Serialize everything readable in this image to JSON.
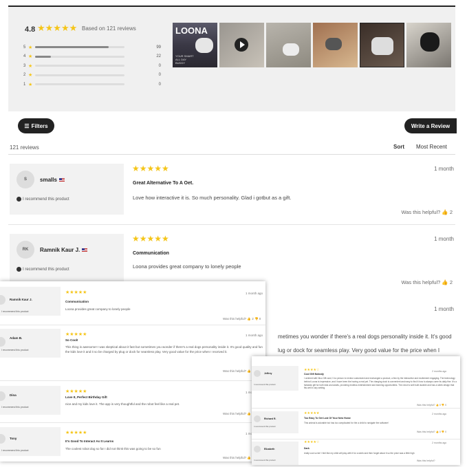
{
  "summary": {
    "average": "4.8",
    "stars": "★★★★★",
    "based_on": "Based on 121 reviews",
    "histogram": [
      {
        "label": "5",
        "count": "99",
        "fraction": 0.82
      },
      {
        "label": "4",
        "count": "22",
        "fraction": 0.18
      },
      {
        "label": "3",
        "count": "0",
        "fraction": 0
      },
      {
        "label": "2",
        "count": "0",
        "fraction": 0
      },
      {
        "label": "1",
        "count": "0",
        "fraction": 0
      }
    ],
    "thumb1_title": "LOONA",
    "thumb1_subtitle": "YOUR SMART ALL DAY BUDDY"
  },
  "toolbar": {
    "filters_label": "Filters",
    "write_label": "Write a Review",
    "review_count": "121 reviews",
    "sort_label": "Sort",
    "sort_value": "Most Recent"
  },
  "reviews": [
    {
      "initials": "S",
      "name": "smalls",
      "recommend": "I recommend this product",
      "stars": "★★★★★",
      "date": "1 month",
      "title": "Great Alternative To A Oet.",
      "body": "Love how interactive it is. So much personality. Glad i gotbut as a gift.",
      "helpful": "Was this helpful?",
      "helpful_count": "2"
    },
    {
      "initials": "RK",
      "name": "Ramnik Kaur J.",
      "recommend": "I recommend this product",
      "stars": "★★★★★",
      "date": "1 month",
      "title": "Communication",
      "body": "Loona provides great company to lonely people",
      "helpful": "Was this helpful?",
      "helpful_count": "2"
    },
    {
      "date": "1 month",
      "body_line1": "metimes you wonder if there's a real dogs personality inside it. It's good",
      "body_line2": "lug or dock for seamless play. Very good value for the price when I"
    }
  ],
  "overlay_a": [
    {
      "name": "Ramnik Kaur J.",
      "recommend": "I recommend this product",
      "stars": "★★★★★",
      "title": "Communication",
      "body": "Loona provides great company to lonely people",
      "date": "1 month ago",
      "helpful": "Was this helpful? 👍 2 👎 0"
    },
    {
      "name": "Adam B.",
      "recommend": "I recommend this product",
      "stars": "★★★★★",
      "title": "So Cool!",
      "body": "This thing is awesome! I was skeptical about it fast but sometimes you wonder if there's a real dogs personality inside it. It's good quality and fun the kids love it and it so be charged by plug or dock for seamless play. Very good value for the price when I received it.",
      "date": "1 month ago",
      "helpful": "Was this helpful? 👍 2 👎 0"
    },
    {
      "name": "Dina",
      "recommend": "I recommend this product",
      "stars": "★★★★★",
      "title": "Love It, Perfect Birthday Gift",
      "body": "nice and my kids love it. The app is very thoughtful and the robot feel like a real pet.",
      "date": "1 month ago",
      "helpful": "Was this helpful? 👍 0 👎 0"
    },
    {
      "name": "Tony",
      "recommend": "I recommend this product",
      "stars": "★★★★★",
      "title": "It's Good To Interact As It Learns",
      "body": "The coolest robot dog so far I did not think this was going to be so fun",
      "date": "1 month ago",
      "helpful": "Was this helpful? 👍 0 👎 0"
    }
  ],
  "overlay_b": [
    {
      "name": "Jeffrey",
      "recommend": "I recommend this product",
      "stars": "★★★★☆",
      "title": "Cool Gift Nobody",
      "body": "I ordered with Nico Gift card, I'd a person to review customized and exchanged a product, a few by the interactive and excitement engaging. The technology behind Loona is impressive, and I have been the having a real pet. The charging dock is convenient and easy to find it how to always come its daily fine. It's a fantastic gift for both kids and adults, providing endless entertainment and learning opportunities. The robot is well built durable and has a sleek design that fits well in any setting.",
      "date": "2 months ago",
      "helpful": "Was this helpful? 👍 0 👎 0"
    },
    {
      "name": "Richard R.",
      "recommend": "I recommend this product",
      "stars": "★★★★★",
      "title": "Too Easy To Get Lost Of Your New Home",
      "body": "This animal is adorable but has too complicated for the a child to navigate the software!",
      "date": "2 months ago",
      "helpful": "Was this helpful? 👍 0 👎 0"
    },
    {
      "name": "Elizabeth",
      "recommend": "I recommend this product",
      "stars": "★★★★☆",
      "title": "Dark",
      "body": "really cool so far! I feel like my child will play with it for a week and then forget about it so the price was a little high",
      "date": "2 months ago",
      "helpful": "Was this helpful?"
    }
  ]
}
